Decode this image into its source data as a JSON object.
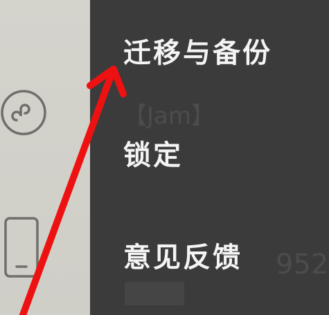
{
  "sidebar": {
    "icons": [
      "mini-program-icon",
      "phone-icon"
    ]
  },
  "menu": {
    "items": [
      {
        "label": "迁移与备份"
      },
      {
        "label": "锁定"
      },
      {
        "label": "意见反馈"
      }
    ]
  },
  "background_text": {
    "line1": "【Jam】",
    "line2": "952"
  },
  "colors": {
    "sidebar_bg": "#d4d3cc",
    "menu_bg": "#3b3b3b",
    "menu_text": "#f4f4f4",
    "annotation_arrow": "#ee1111"
  }
}
